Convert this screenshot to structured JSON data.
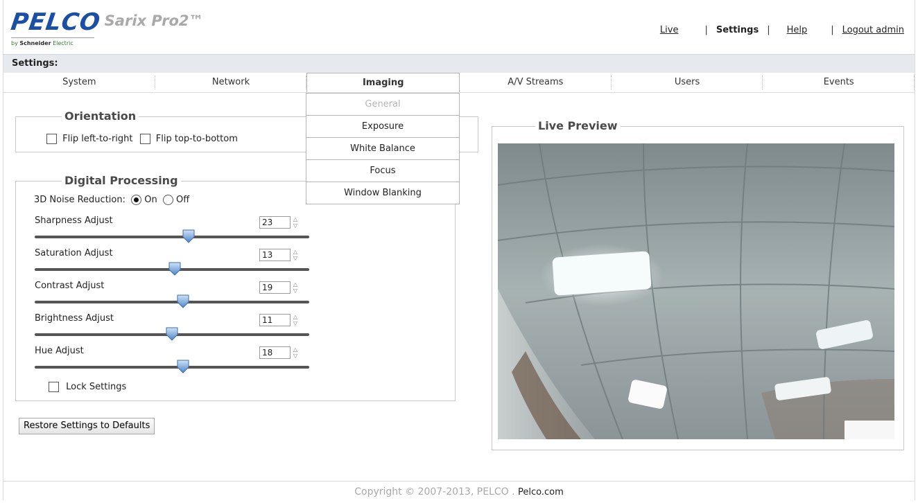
{
  "brand": {
    "logo": "PELCO",
    "product": "Sarix Pro2™",
    "byline_prefix": "by",
    "byline_company": "Schneider",
    "byline_suffix": "Electric"
  },
  "topnav": {
    "live": "Live",
    "sep": "|",
    "settings": "Settings",
    "help": "Help",
    "logout": "Logout admin"
  },
  "settings_label": "Settings:",
  "tabs": [
    "System",
    "Network",
    "Imaging",
    "A/V Streams",
    "Users",
    "Events"
  ],
  "imaging_menu": [
    "General",
    "Exposure",
    "White Balance",
    "Focus",
    "Window Blanking"
  ],
  "orientation": {
    "legend": "Orientation",
    "flip_lr": "Flip left-to-right",
    "flip_tb": "Flip top-to-bottom"
  },
  "digital": {
    "legend": "Digital Processing",
    "noise_label": "3D Noise Reduction:",
    "noise_on": "On",
    "noise_off": "Off",
    "sliders": [
      {
        "label": "Sharpness Adjust",
        "value": "23",
        "level": 0.56
      },
      {
        "label": "Saturation Adjust",
        "value": "13",
        "level": 0.51
      },
      {
        "label": "Contrast Adjust",
        "value": "19",
        "level": 0.54
      },
      {
        "label": "Brightness Adjust",
        "value": "11",
        "level": 0.5
      },
      {
        "label": "Hue Adjust",
        "value": "18",
        "level": 0.54
      }
    ],
    "lock": "Lock Settings"
  },
  "restore_button": "Restore Settings to Defaults",
  "preview": {
    "legend": "Live Preview"
  },
  "footer": {
    "copyright": "Copyright © 2007-2013, PELCO .",
    "link": "Pelco.com"
  }
}
